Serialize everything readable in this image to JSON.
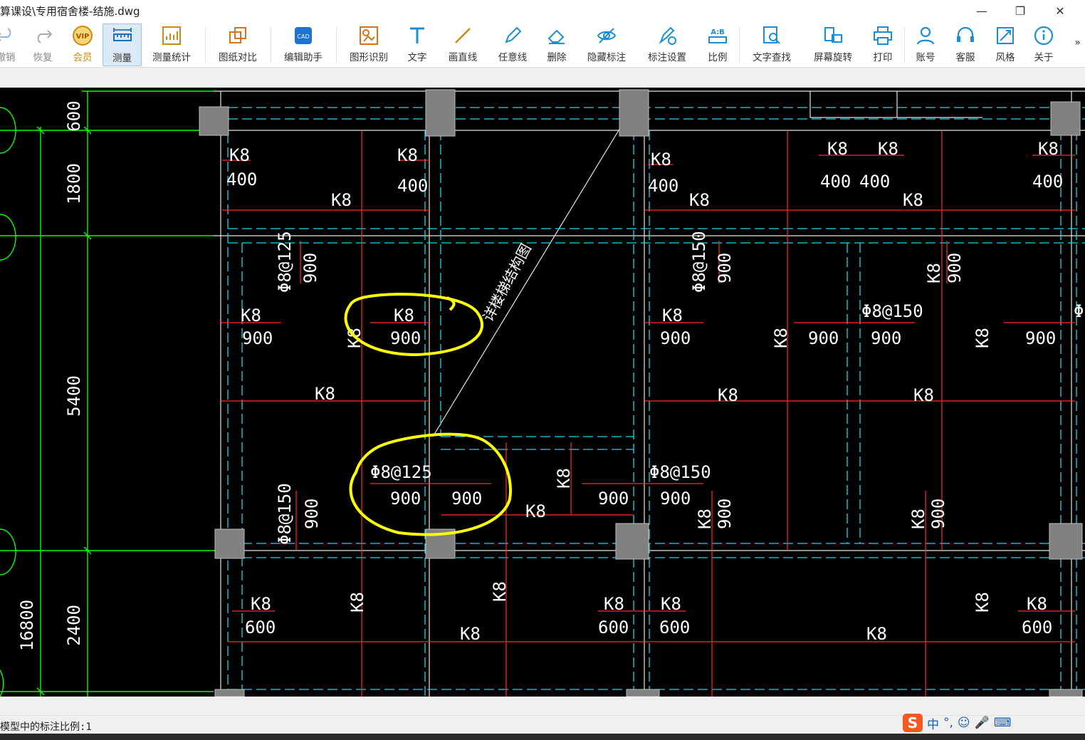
{
  "window": {
    "title": "算课设\\专用宿舍楼-结施.dwg",
    "minimize": "—",
    "restore": "❐",
    "close": "✕"
  },
  "toolbar": {
    "undo": "撤销",
    "redo": "恢复",
    "vip": "会员",
    "measure": "测量",
    "measure_stats": "测量统计",
    "compare": "图纸对比",
    "edit_helper": "编辑助手",
    "shape_recog": "图形识别",
    "text": "文字",
    "line": "画直线",
    "freeline": "任意线",
    "delete": "删除",
    "hide_dim": "隐藏标注",
    "dim_settings": "标注设置",
    "scale": "比例",
    "find_text": "文字查找",
    "rotate": "屏幕旋转",
    "print": "打印",
    "account": "账号",
    "service": "客服",
    "style": "风格",
    "about": "关于",
    "more": "»"
  },
  "drawing": {
    "dims_left": [
      "600",
      "1800",
      "5400",
      "2400",
      "16800"
    ],
    "labels": {
      "k8": "K8",
      "v400": "400",
      "v900": "900",
      "v600": "600",
      "phi8_125": "Φ8@125",
      "phi8_150": "Φ8@150",
      "diag_note": "详楼梯结构图"
    },
    "colors": {
      "background": "#000000",
      "rebar": "#ff2a2a",
      "axis": "#00ff00",
      "beam_edge": "#22d3ee",
      "column": "#808080",
      "highlight": "#ffff00"
    }
  },
  "status": {
    "text": "模型中的标注比例:1"
  },
  "ime": {
    "logo": "S",
    "mode": "中",
    "punct": "°,",
    "emoji": "☺",
    "mic": "🎤",
    "keyboard": "⌨"
  }
}
